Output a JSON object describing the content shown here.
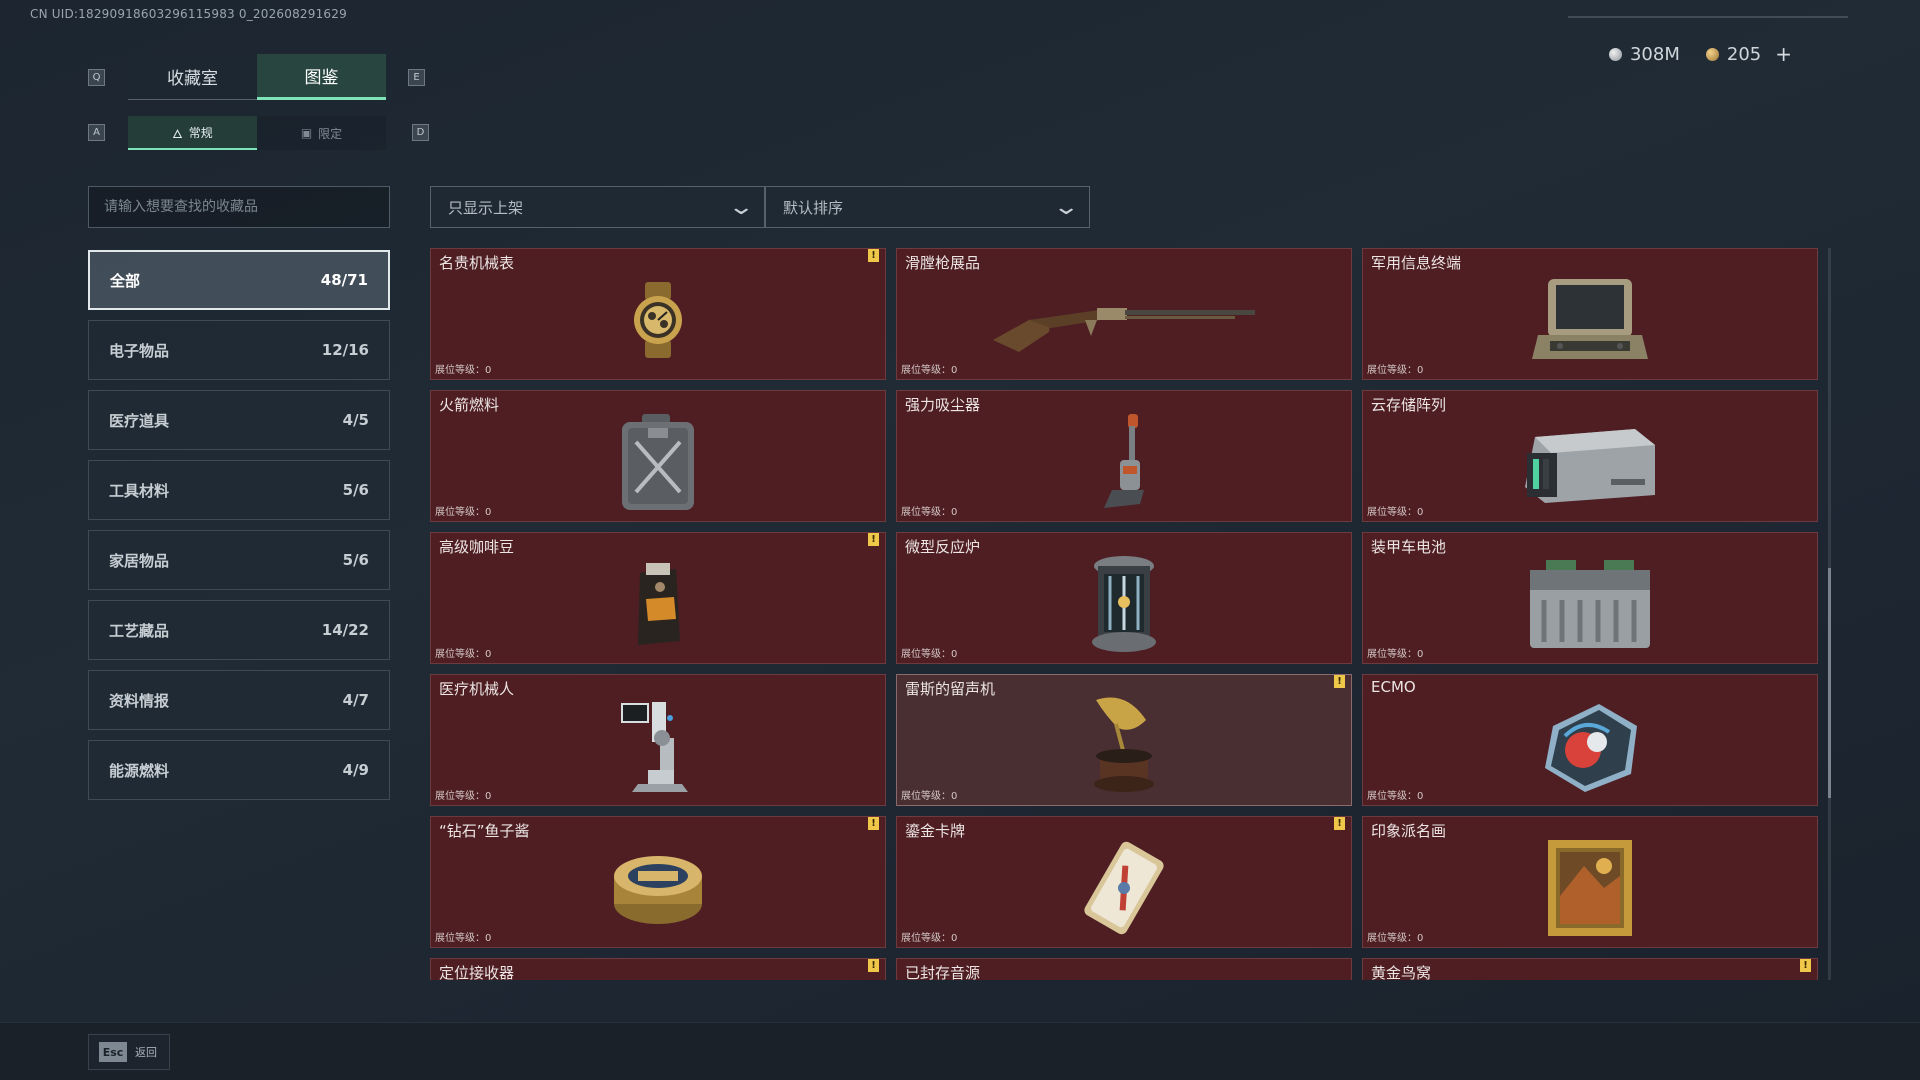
{
  "uid": "CN UID:18290918603296115983 0_202608291629",
  "currency": {
    "silver": "308M",
    "gold": "205",
    "add": "+"
  },
  "key_hints": {
    "prev_tab": "Q",
    "next_tab": "E",
    "prev_sub": "A",
    "next_sub": "D"
  },
  "main_tabs": [
    {
      "label": "收藏室",
      "active": false
    },
    {
      "label": "图鉴",
      "active": true
    }
  ],
  "sub_tabs": [
    {
      "label": "常规",
      "active": true
    },
    {
      "label": "限定",
      "active": false
    }
  ],
  "search": {
    "placeholder": "请输入想要查找的收藏品"
  },
  "filters": {
    "shelf_filter": "只显示上架",
    "sort": "默认排序"
  },
  "categories": [
    {
      "label": "全部",
      "count": "48/71",
      "active": true
    },
    {
      "label": "电子物品",
      "count": "12/16"
    },
    {
      "label": "医疗道具",
      "count": "4/5"
    },
    {
      "label": "工具材料",
      "count": "5/6"
    },
    {
      "label": "家居物品",
      "count": "5/6"
    },
    {
      "label": "工艺藏品",
      "count": "14/22"
    },
    {
      "label": "资料情报",
      "count": "4/7"
    },
    {
      "label": "能源燃料",
      "count": "4/9"
    }
  ],
  "items": [
    {
      "name": "名贵机械表",
      "level": "展位等级：0",
      "flag": true,
      "icon": "watch"
    },
    {
      "name": "滑膛枪展品",
      "level": "展位等级：0",
      "flag": false,
      "icon": "musket"
    },
    {
      "name": "军用信息终端",
      "level": "展位等级：0",
      "flag": false,
      "icon": "terminal"
    },
    {
      "name": "火箭燃料",
      "level": "展位等级：0",
      "flag": false,
      "icon": "jerrycan"
    },
    {
      "name": "强力吸尘器",
      "level": "展位等级：0",
      "flag": false,
      "icon": "vacuum"
    },
    {
      "name": "云存储阵列",
      "level": "展位等级：0",
      "flag": false,
      "icon": "storage"
    },
    {
      "name": "高级咖啡豆",
      "level": "展位等级：0",
      "flag": true,
      "icon": "coffee"
    },
    {
      "name": "微型反应炉",
      "level": "展位等级：0",
      "flag": false,
      "icon": "reactor"
    },
    {
      "name": "装甲车电池",
      "level": "展位等级：0",
      "flag": false,
      "icon": "battery"
    },
    {
      "name": "医疗机械人",
      "level": "展位等级：0",
      "flag": false,
      "icon": "robot"
    },
    {
      "name": "雷斯的留声机",
      "level": "展位等级：0",
      "flag": true,
      "icon": "gramophone",
      "dim": true
    },
    {
      "name": "ECMO",
      "level": "展位等级：0",
      "flag": false,
      "icon": "ecmo"
    },
    {
      "name": "“钻石”鱼子酱",
      "level": "展位等级：0",
      "flag": true,
      "icon": "caviar"
    },
    {
      "name": "鎏金卡牌",
      "level": "展位等级：0",
      "flag": true,
      "icon": "card"
    },
    {
      "name": "印象派名画",
      "level": "展位等级：0",
      "flag": false,
      "icon": "painting"
    },
    {
      "name": "定位接收器",
      "level": "",
      "flag": true,
      "icon": ""
    },
    {
      "name": "已封存音源",
      "level": "",
      "flag": false,
      "icon": ""
    },
    {
      "name": "黄金鸟窝",
      "level": "",
      "flag": true,
      "icon": ""
    }
  ],
  "footer": {
    "esc_key": "Esc",
    "back_label": "返回"
  }
}
